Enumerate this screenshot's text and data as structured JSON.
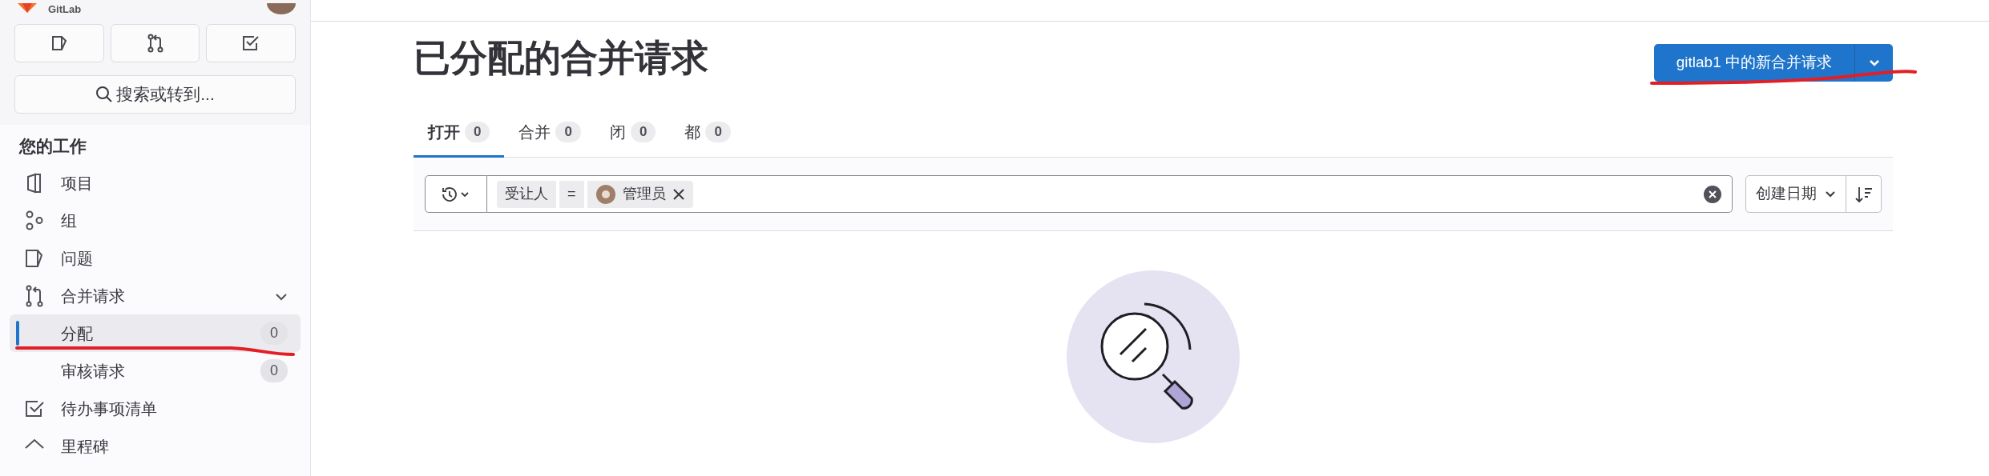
{
  "sidebar": {
    "brand": "GitLab",
    "search": {
      "label": "搜索或转到..."
    },
    "section_title": "您的工作",
    "items": [
      {
        "label": "项目",
        "selected": false
      },
      {
        "label": "组",
        "selected": false
      },
      {
        "label": "问题",
        "selected": false
      },
      {
        "label": "合并请求",
        "selected": false,
        "expanded": true,
        "children": [
          {
            "label": "分配",
            "count": "0",
            "selected": true
          },
          {
            "label": "审核请求",
            "count": "0",
            "selected": false
          }
        ]
      },
      {
        "label": "待办事项清单",
        "selected": false
      },
      {
        "label": "里程碑",
        "selected": false
      }
    ]
  },
  "main": {
    "title": "已分配的合并请求",
    "new_button": {
      "label": "gitlab1 中的新合并请求"
    },
    "tabs": [
      {
        "label": "打开",
        "count": "0",
        "selected": true
      },
      {
        "label": "合并",
        "count": "0",
        "selected": false
      },
      {
        "label": "闭",
        "count": "0",
        "selected": false
      },
      {
        "label": "都",
        "count": "0",
        "selected": false
      }
    ],
    "filter": {
      "tokens": [
        {
          "field": "受让人",
          "operator": "=",
          "value": "管理员"
        }
      ]
    },
    "sort": {
      "label": "创建日期"
    }
  }
}
